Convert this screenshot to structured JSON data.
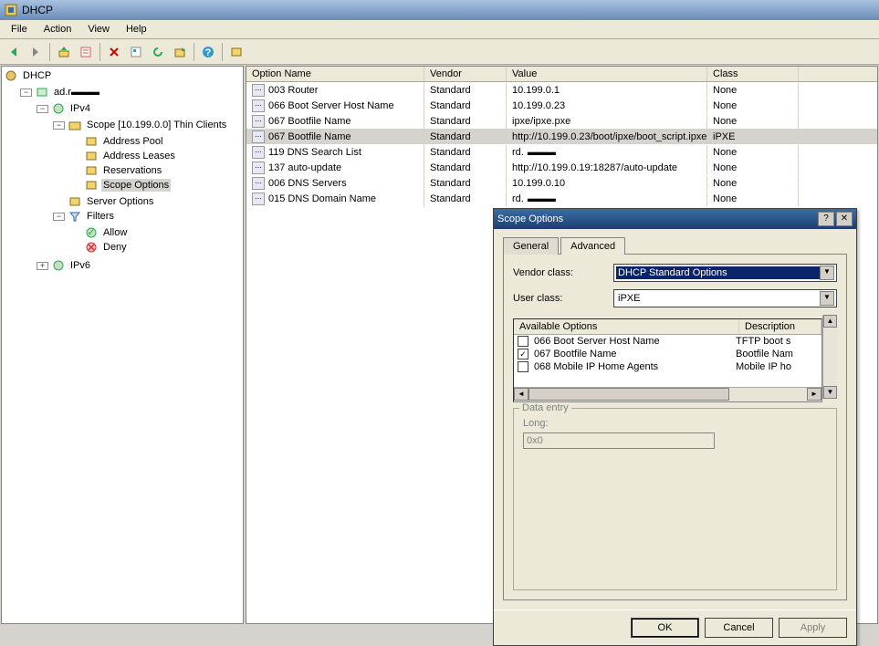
{
  "window": {
    "title": "DHCP"
  },
  "menu": {
    "file": "File",
    "action": "Action",
    "view": "View",
    "help": "Help"
  },
  "tree": {
    "root": "DHCP",
    "server": "ad.r",
    "ipv4": "IPv4",
    "scope": "Scope [10.199.0.0] Thin Clients",
    "address_pool": "Address Pool",
    "address_leases": "Address Leases",
    "reservations": "Reservations",
    "scope_options": "Scope Options",
    "server_options": "Server Options",
    "filters": "Filters",
    "allow": "Allow",
    "deny": "Deny",
    "ipv6": "IPv6"
  },
  "list": {
    "cols": {
      "name": "Option Name",
      "vendor": "Vendor",
      "value": "Value",
      "class": "Class"
    },
    "rows": [
      {
        "name": "003 Router",
        "vendor": "Standard",
        "value": "10.199.0.1",
        "class": "None"
      },
      {
        "name": "066 Boot Server Host Name",
        "vendor": "Standard",
        "value": "10.199.0.23",
        "class": "None"
      },
      {
        "name": "067 Bootfile Name",
        "vendor": "Standard",
        "value": "ipxe/ipxe.pxe",
        "class": "None"
      },
      {
        "name": "067 Bootfile Name",
        "vendor": "Standard",
        "value": "http://10.199.0.23/boot/ipxe/boot_script.ipxe",
        "class": "iPXE",
        "selected": true
      },
      {
        "name": "119 DNS Search List",
        "vendor": "Standard",
        "value": "rd.",
        "class": "None",
        "redact": true
      },
      {
        "name": "137 auto-update",
        "vendor": "Standard",
        "value": "http://10.199.0.19:18287/auto-update",
        "class": "None"
      },
      {
        "name": "006 DNS Servers",
        "vendor": "Standard",
        "value": "10.199.0.10",
        "class": "None"
      },
      {
        "name": "015 DNS Domain Name",
        "vendor": "Standard",
        "value": "rd.",
        "class": "None",
        "redact": true
      }
    ]
  },
  "dialog": {
    "title": "Scope Options",
    "tabs": {
      "general": "General",
      "advanced": "Advanced"
    },
    "vendor_label": "Vendor class:",
    "vendor_value": "DHCP Standard Options",
    "user_label": "User class:",
    "user_value": "iPXE",
    "options_header": {
      "available": "Available Options",
      "desc": "Description"
    },
    "options": [
      {
        "checked": false,
        "label": "066 Boot Server Host Name",
        "desc": "TFTP boot s"
      },
      {
        "checked": true,
        "label": "067 Bootfile Name",
        "desc": "Bootfile Nam"
      },
      {
        "checked": false,
        "label": "068 Mobile IP Home Agents",
        "desc": "Mobile IP ho"
      }
    ],
    "data_entry": {
      "legend": "Data entry",
      "long_label": "Long:",
      "long_value": "0x0"
    },
    "buttons": {
      "ok": "OK",
      "cancel": "Cancel",
      "apply": "Apply"
    }
  }
}
